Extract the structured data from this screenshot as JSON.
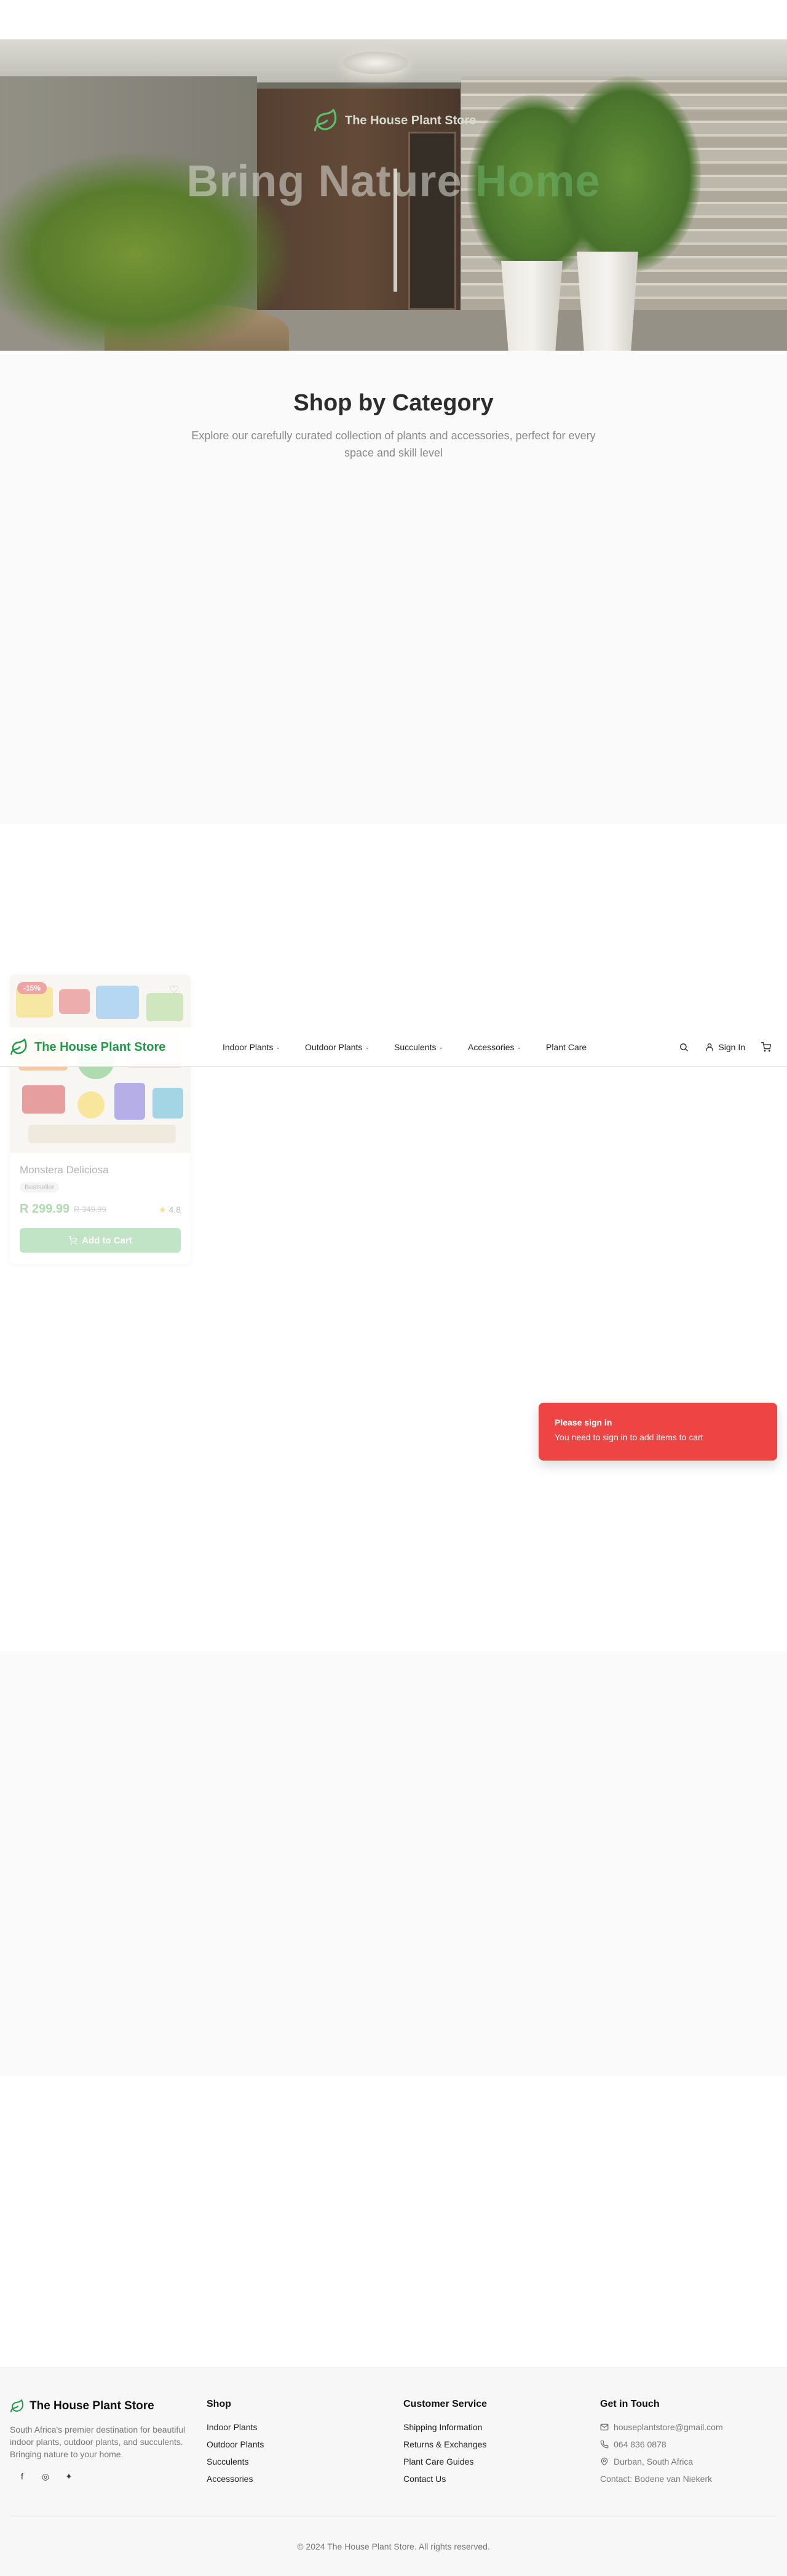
{
  "hero": {
    "brand": "The House Plant Store",
    "headline_main": "Bring Nature ",
    "headline_accent": "Home"
  },
  "categories": {
    "title": "Shop by Category",
    "subtitle": "Explore our carefully curated collection of plants and accessories, perfect for every space and skill level"
  },
  "navbar": {
    "brand": "The House Plant Store",
    "links": [
      "Indoor Plants",
      "Outdoor Plants",
      "Succulents",
      "Accessories",
      "Plant Care"
    ],
    "sign_in": "Sign In"
  },
  "product": {
    "badge": "-15%",
    "name": "Monstera Deliciosa",
    "tag": "Bestseller",
    "price": "R 299.99",
    "old_price": "R 349.99",
    "rating": "4.8",
    "add_to_cart": "Add to Cart"
  },
  "toast": {
    "title": "Please sign in",
    "body": "You need to sign in to add items to cart"
  },
  "footer": {
    "brand": "The House Plant Store",
    "description": "South Africa's premier destination for beautiful indoor plants, outdoor plants, and succulents. Bringing nature to your home.",
    "shop_heading": "Shop",
    "shop_links": [
      "Indoor Plants",
      "Outdoor Plants",
      "Succulents",
      "Accessories"
    ],
    "service_heading": "Customer Service",
    "service_links": [
      "Shipping Information",
      "Returns & Exchanges",
      "Plant Care Guides",
      "Contact Us"
    ],
    "contact_heading": "Get in Touch",
    "email": "houseplantstore@gmail.com",
    "phone": "064 836 0878",
    "location": "Durban, South Africa",
    "contact_person": "Contact: Bodene van Niekerk",
    "copyright": "© 2024 The House Plant Store. All rights reserved."
  },
  "colors": {
    "brand_green": "#1f9a46",
    "toast_red": "#ef4444",
    "price_green": "#6cbf6c"
  }
}
